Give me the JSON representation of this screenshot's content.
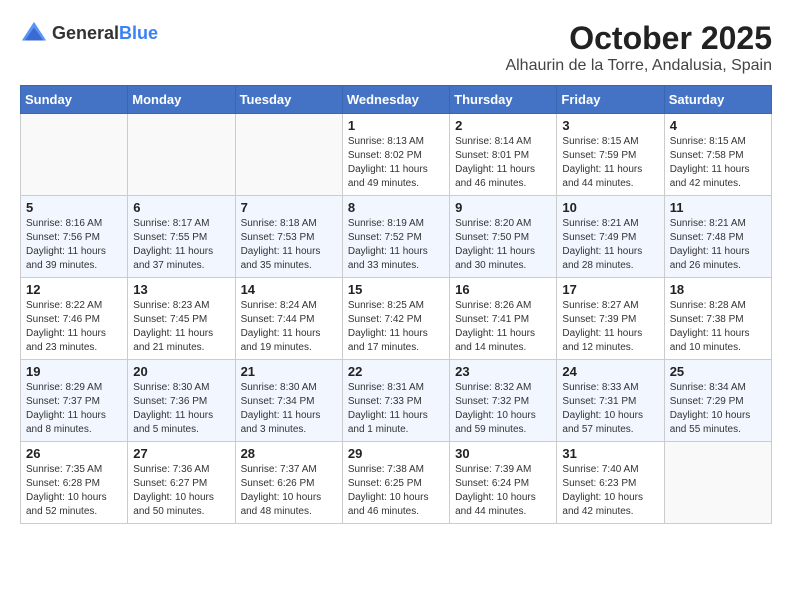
{
  "logo": {
    "general": "General",
    "blue": "Blue"
  },
  "title": "October 2025",
  "location": "Alhaurin de la Torre, Andalusia, Spain",
  "days_of_week": [
    "Sunday",
    "Monday",
    "Tuesday",
    "Wednesday",
    "Thursday",
    "Friday",
    "Saturday"
  ],
  "weeks": [
    [
      {
        "day": "",
        "info": ""
      },
      {
        "day": "",
        "info": ""
      },
      {
        "day": "",
        "info": ""
      },
      {
        "day": "1",
        "info": "Sunrise: 8:13 AM\nSunset: 8:02 PM\nDaylight: 11 hours and 49 minutes."
      },
      {
        "day": "2",
        "info": "Sunrise: 8:14 AM\nSunset: 8:01 PM\nDaylight: 11 hours and 46 minutes."
      },
      {
        "day": "3",
        "info": "Sunrise: 8:15 AM\nSunset: 7:59 PM\nDaylight: 11 hours and 44 minutes."
      },
      {
        "day": "4",
        "info": "Sunrise: 8:15 AM\nSunset: 7:58 PM\nDaylight: 11 hours and 42 minutes."
      }
    ],
    [
      {
        "day": "5",
        "info": "Sunrise: 8:16 AM\nSunset: 7:56 PM\nDaylight: 11 hours and 39 minutes."
      },
      {
        "day": "6",
        "info": "Sunrise: 8:17 AM\nSunset: 7:55 PM\nDaylight: 11 hours and 37 minutes."
      },
      {
        "day": "7",
        "info": "Sunrise: 8:18 AM\nSunset: 7:53 PM\nDaylight: 11 hours and 35 minutes."
      },
      {
        "day": "8",
        "info": "Sunrise: 8:19 AM\nSunset: 7:52 PM\nDaylight: 11 hours and 33 minutes."
      },
      {
        "day": "9",
        "info": "Sunrise: 8:20 AM\nSunset: 7:50 PM\nDaylight: 11 hours and 30 minutes."
      },
      {
        "day": "10",
        "info": "Sunrise: 8:21 AM\nSunset: 7:49 PM\nDaylight: 11 hours and 28 minutes."
      },
      {
        "day": "11",
        "info": "Sunrise: 8:21 AM\nSunset: 7:48 PM\nDaylight: 11 hours and 26 minutes."
      }
    ],
    [
      {
        "day": "12",
        "info": "Sunrise: 8:22 AM\nSunset: 7:46 PM\nDaylight: 11 hours and 23 minutes."
      },
      {
        "day": "13",
        "info": "Sunrise: 8:23 AM\nSunset: 7:45 PM\nDaylight: 11 hours and 21 minutes."
      },
      {
        "day": "14",
        "info": "Sunrise: 8:24 AM\nSunset: 7:44 PM\nDaylight: 11 hours and 19 minutes."
      },
      {
        "day": "15",
        "info": "Sunrise: 8:25 AM\nSunset: 7:42 PM\nDaylight: 11 hours and 17 minutes."
      },
      {
        "day": "16",
        "info": "Sunrise: 8:26 AM\nSunset: 7:41 PM\nDaylight: 11 hours and 14 minutes."
      },
      {
        "day": "17",
        "info": "Sunrise: 8:27 AM\nSunset: 7:39 PM\nDaylight: 11 hours and 12 minutes."
      },
      {
        "day": "18",
        "info": "Sunrise: 8:28 AM\nSunset: 7:38 PM\nDaylight: 11 hours and 10 minutes."
      }
    ],
    [
      {
        "day": "19",
        "info": "Sunrise: 8:29 AM\nSunset: 7:37 PM\nDaylight: 11 hours and 8 minutes."
      },
      {
        "day": "20",
        "info": "Sunrise: 8:30 AM\nSunset: 7:36 PM\nDaylight: 11 hours and 5 minutes."
      },
      {
        "day": "21",
        "info": "Sunrise: 8:30 AM\nSunset: 7:34 PM\nDaylight: 11 hours and 3 minutes."
      },
      {
        "day": "22",
        "info": "Sunrise: 8:31 AM\nSunset: 7:33 PM\nDaylight: 11 hours and 1 minute."
      },
      {
        "day": "23",
        "info": "Sunrise: 8:32 AM\nSunset: 7:32 PM\nDaylight: 10 hours and 59 minutes."
      },
      {
        "day": "24",
        "info": "Sunrise: 8:33 AM\nSunset: 7:31 PM\nDaylight: 10 hours and 57 minutes."
      },
      {
        "day": "25",
        "info": "Sunrise: 8:34 AM\nSunset: 7:29 PM\nDaylight: 10 hours and 55 minutes."
      }
    ],
    [
      {
        "day": "26",
        "info": "Sunrise: 7:35 AM\nSunset: 6:28 PM\nDaylight: 10 hours and 52 minutes."
      },
      {
        "day": "27",
        "info": "Sunrise: 7:36 AM\nSunset: 6:27 PM\nDaylight: 10 hours and 50 minutes."
      },
      {
        "day": "28",
        "info": "Sunrise: 7:37 AM\nSunset: 6:26 PM\nDaylight: 10 hours and 48 minutes."
      },
      {
        "day": "29",
        "info": "Sunrise: 7:38 AM\nSunset: 6:25 PM\nDaylight: 10 hours and 46 minutes."
      },
      {
        "day": "30",
        "info": "Sunrise: 7:39 AM\nSunset: 6:24 PM\nDaylight: 10 hours and 44 minutes."
      },
      {
        "day": "31",
        "info": "Sunrise: 7:40 AM\nSunset: 6:23 PM\nDaylight: 10 hours and 42 minutes."
      },
      {
        "day": "",
        "info": ""
      }
    ]
  ]
}
